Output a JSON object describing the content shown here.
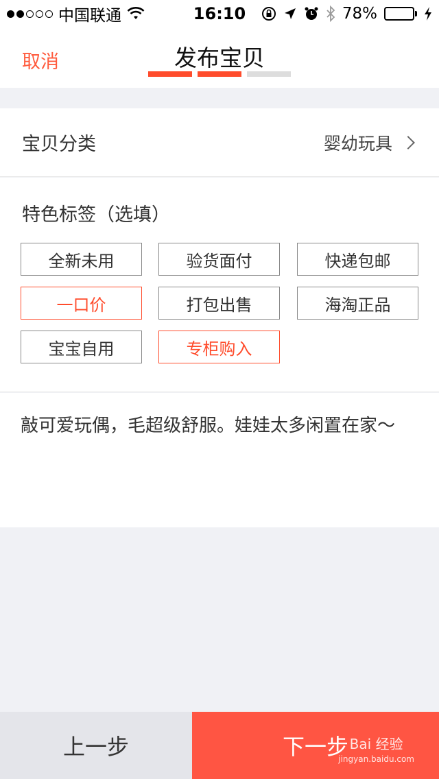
{
  "status_bar": {
    "carrier": "中国联通",
    "time": "16:10",
    "battery_percent": "78%",
    "battery_level": 0.78,
    "battery_color": "#f5c500"
  },
  "nav": {
    "cancel_label": "取消",
    "title": "发布宝贝",
    "step_current": 2,
    "step_total": 3
  },
  "category": {
    "label": "宝贝分类",
    "value": "婴幼玩具"
  },
  "tags": {
    "title": "特色标签（选填）",
    "items": [
      {
        "label": "全新未用",
        "selected": false
      },
      {
        "label": "验货面付",
        "selected": false
      },
      {
        "label": "快递包邮",
        "selected": false
      },
      {
        "label": "一口价",
        "selected": true
      },
      {
        "label": "打包出售",
        "selected": false
      },
      {
        "label": "海淘正品",
        "selected": false
      },
      {
        "label": "宝宝自用",
        "selected": false
      },
      {
        "label": "专柜购入",
        "selected": true
      }
    ]
  },
  "description": {
    "text": "敲可爱玩偶，毛超级舒服。娃娃太多闲置在家～"
  },
  "bottom": {
    "prev_label": "上一步",
    "next_label": "下一步"
  },
  "watermark": {
    "main": "Bai 经验",
    "sub": "jingyan.baidu.com"
  },
  "colors": {
    "accent": "#ff4c2c",
    "next_button": "#ff5543",
    "prev_button": "#e4e5ea",
    "background": "#f0f1f5"
  }
}
